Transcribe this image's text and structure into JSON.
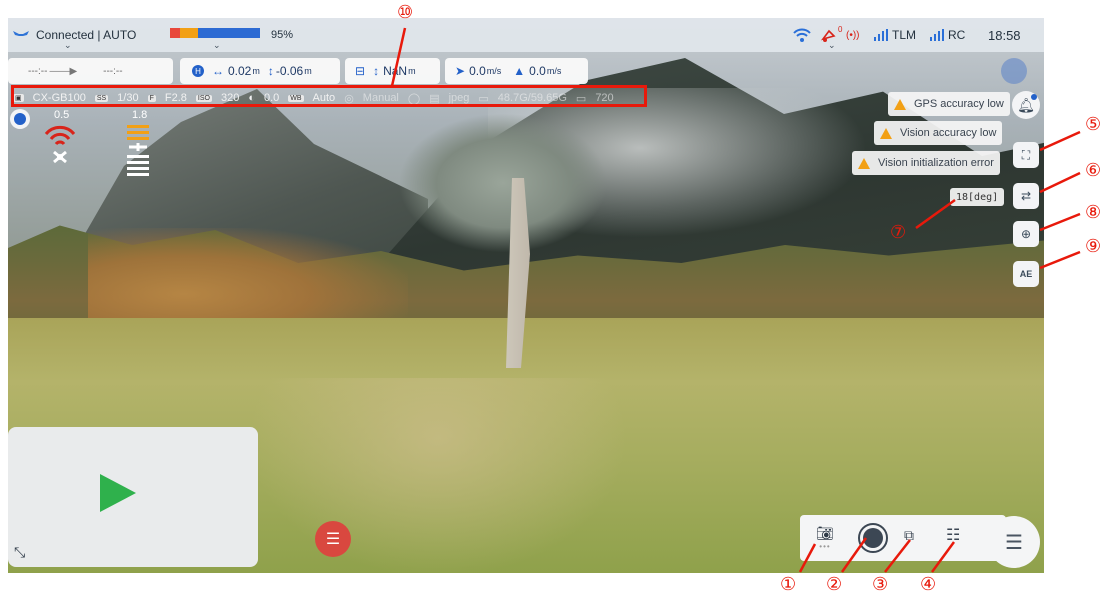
{
  "status": {
    "connection": "Connected | AUTO",
    "battery_percent": "95%",
    "battery_level": 0.95,
    "gps_count": "0",
    "tlm": "TLM",
    "rc": "RC",
    "time": "18:58"
  },
  "nav": {
    "timeline_start": "---:--",
    "timeline_end": "---:--",
    "h_dist": "0.02",
    "v_dist": "-0.06",
    "dist_unit": "m",
    "rc_height": "NaN",
    "h_speed": "0.0",
    "v_speed": "0.0",
    "speed_unit": "m/s"
  },
  "camera": {
    "model": "CX-GB100",
    "shutter": "1/30",
    "aperture": "F2.8",
    "iso": "320",
    "ev": "0.0",
    "wb": "Auto",
    "focus": "Manual",
    "format": "jpeg",
    "storage": "48.7G/59.65G",
    "resolution": "720"
  },
  "signal": {
    "value_a": "0.5",
    "value_b": "1.8"
  },
  "warnings": [
    "GPS accuracy low",
    "Vision accuracy low",
    "Vision initialization error"
  ],
  "gimbal_angle": "18[deg]",
  "annotations": {
    "a1": "①",
    "a2": "②",
    "a3": "③",
    "a4": "④",
    "a5": "⑤",
    "a6": "⑥",
    "a7": "⑦",
    "a8": "⑧",
    "a9": "⑨",
    "a10": "⑩"
  },
  "colors": {
    "accent": "#2361c9",
    "warning": "#f2a015",
    "record": "#d9483f",
    "annotation": "#e8190b",
    "signal_red": "#d8241a",
    "signal_orange": "#f2a015"
  }
}
